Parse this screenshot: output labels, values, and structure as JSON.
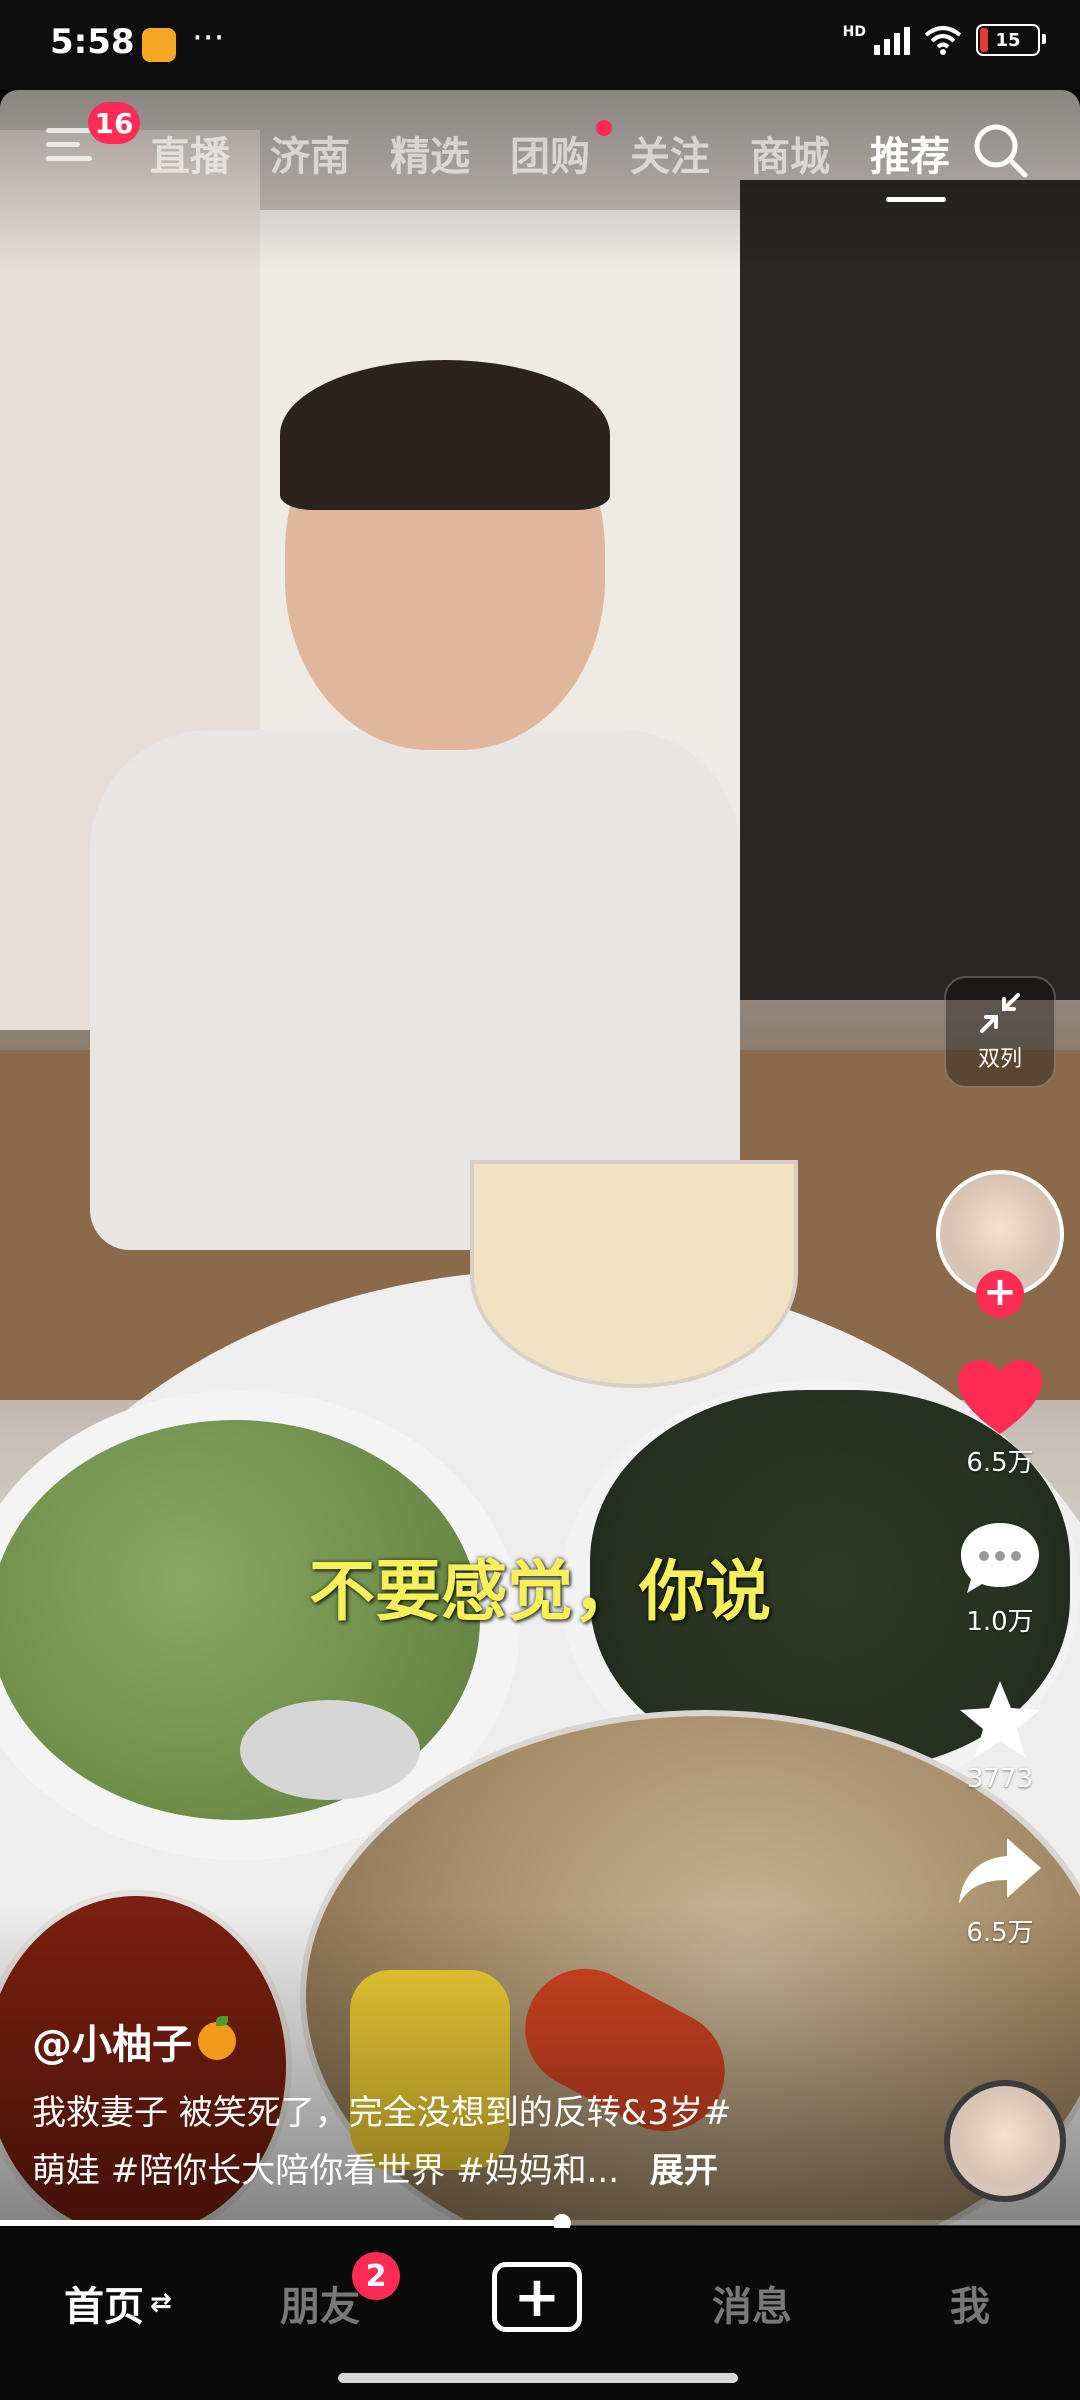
{
  "status_bar": {
    "time": "5:58",
    "more": "···",
    "network_label": "HD",
    "battery": "15"
  },
  "top_nav": {
    "menu_badge": "16",
    "tabs": [
      "直播",
      "济南",
      "精选",
      "团购",
      "关注",
      "商城",
      "推荐"
    ],
    "active_tab": "推荐",
    "dot_tab": "团购"
  },
  "video": {
    "subtitle": "不要感觉，你说",
    "dual_column_label": "双列"
  },
  "actions": {
    "like_count": "6.5万",
    "comment_count": "1.0万",
    "favorite_count": "3773",
    "share_count": "6.5万",
    "like_color": "#fe2c55"
  },
  "caption": {
    "author": "@小柚子",
    "description_line1": "我救妻子 被笑死了，完全没想到的反转&3岁#",
    "description_line2": "萌娃 #陪你长大陪你看世界 #妈妈和...",
    "expand_label": "展开"
  },
  "progress": {
    "fraction": 0.52
  },
  "bottom_nav": {
    "home": "首页",
    "home_swap": "⇄",
    "friends": "朋友",
    "friends_badge": "2",
    "create": "+",
    "messages": "消息",
    "me": "我"
  },
  "colors": {
    "accent": "#fe2c55",
    "subtitle": "#f6f05a"
  }
}
